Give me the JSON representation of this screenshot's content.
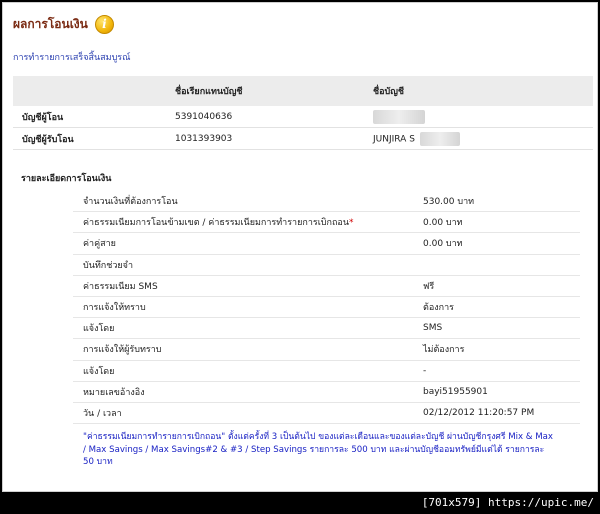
{
  "page": {
    "title": "ผลการโอนเงิน",
    "info_icon": "info-icon"
  },
  "status": "การทำรายการเสร็จสิ้นสมบูรณ์",
  "accounts": {
    "col_alias": "ชื่อเรียกแทนบัญชี",
    "col_name": "ชื่อบัญชี",
    "rows": [
      {
        "label": "บัญชีผู้โอน",
        "alias": "5391040636",
        "name": ""
      },
      {
        "label": "บัญชีผู้รับโอน",
        "alias": "1031393903",
        "name": "JUNJIRA S"
      }
    ]
  },
  "details": {
    "heading": "รายละเอียดการโอนเงิน",
    "rows": [
      {
        "label": "จำนวนเงินที่ต้องการโอน",
        "value": "530.00 บาท"
      },
      {
        "label": "ค่าธรรมเนียมการโอนข้ามเขต / ค่าธรรมเนียมการทำรายการเบิกถอน",
        "value": "0.00 บาท"
      },
      {
        "label": "ค่าคู่สาย",
        "value": "0.00 บาท"
      },
      {
        "label": "บันทึกช่วยจำ",
        "value": ""
      },
      {
        "label": "ค่าธรรมเนียม SMS",
        "value": "ฟรี"
      },
      {
        "label": "การแจ้งให้ทราบ",
        "value": "ต้องการ"
      },
      {
        "label": "แจ้งโดย",
        "value": "SMS"
      },
      {
        "label": "การแจ้งให้ผู้รับทราบ",
        "value": "ไม่ต้องการ"
      },
      {
        "label": "แจ้งโดย",
        "value": "-"
      },
      {
        "label": "หมายเลขอ้างอิง",
        "value": "bayi51955901"
      },
      {
        "label": "วัน / เวลา",
        "value": "02/12/2012 11:20:57 PM"
      }
    ],
    "required_mark": "*"
  },
  "footnote": "\"ค่าธรรมเนียมการทำรายการเบิกถอน\" ตั้งแต่ครั้งที่ 3 เป็นต้นไป ของแต่ละเดือนและของแต่ละบัญชี ผ่านบัญชีกรุงศรี Mix & Max / Max Savings / Max Savings#2 & #3 / Step Savings รายการละ 500 บาท และผ่านบัญชีออมทรัพย์มีแต่ได้ รายการละ 50 บาท",
  "watermark": "[701x579] https://upic.me/"
}
